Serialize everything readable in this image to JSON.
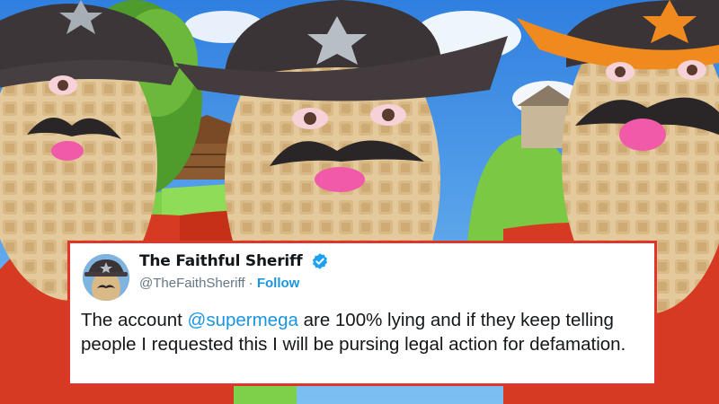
{
  "tweet": {
    "display_name": "The Faithful Sheriff",
    "handle": "@TheFaithSheriff",
    "separator": " · ",
    "follow_label": "Follow",
    "text_before": "The account ",
    "mention": "@supermega",
    "text_after": " are 100% lying and if they keep telling people I requested this I will be pursing legal action for defamation."
  },
  "colors": {
    "card_border": "#e0352b",
    "link_blue": "#1b95e0",
    "verified_blue": "#1da1f2",
    "sky": "#3b8fe8",
    "peanut": "#e2c79a",
    "hat": "#3a3437",
    "bandana": "#d63a22"
  },
  "icons": [
    "verified-badge-icon",
    "star-icon"
  ]
}
